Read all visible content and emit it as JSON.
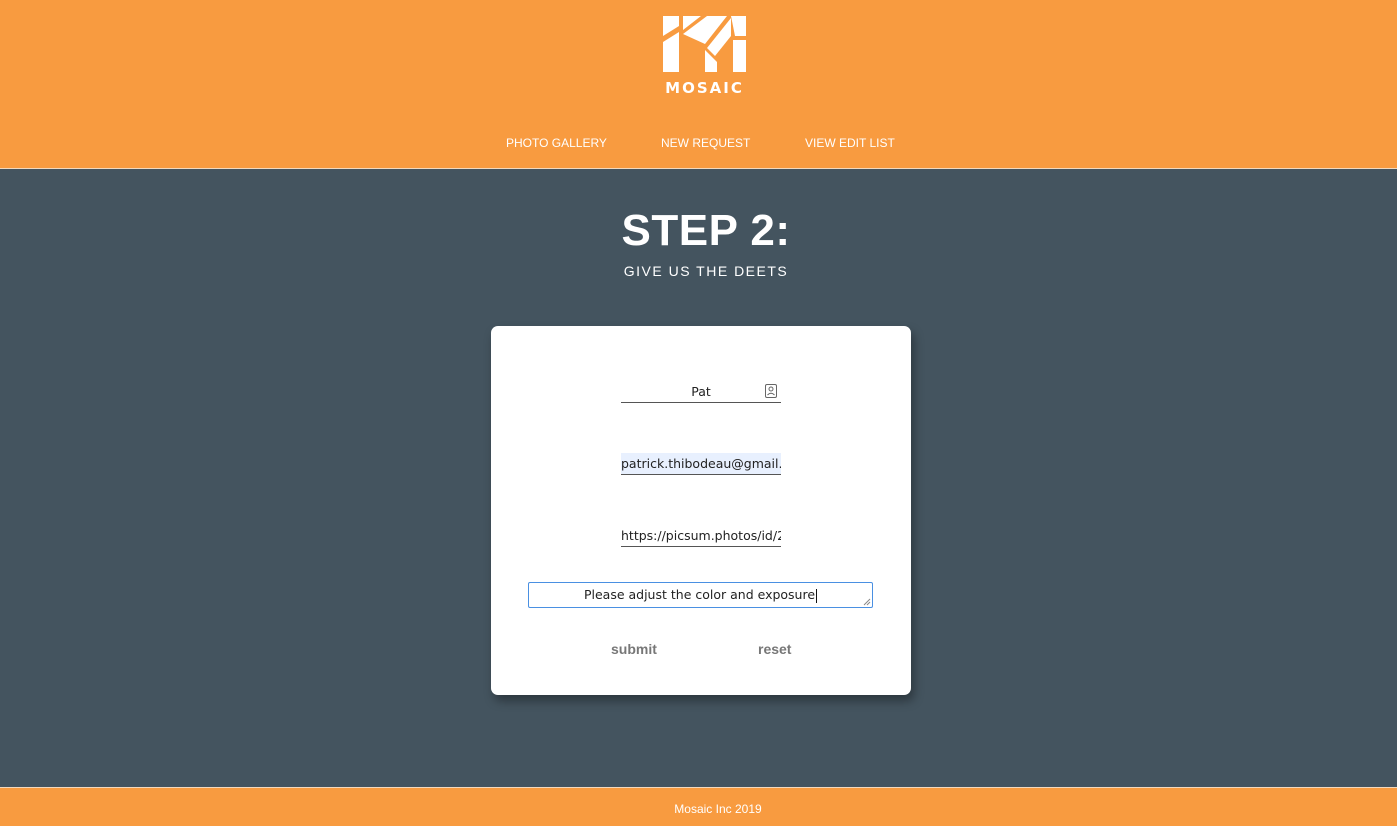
{
  "header": {
    "logo_text": "MOSAIC",
    "nav": [
      {
        "label": "PHOTO GALLERY"
      },
      {
        "label": "NEW REQUEST"
      },
      {
        "label": "VIEW EDIT LIST"
      }
    ]
  },
  "main": {
    "title": "STEP 2:",
    "subtitle": "GIVE US THE DEETS"
  },
  "form": {
    "name_value": "Pat",
    "email_value": "patrick.thibodeau@gmail.c",
    "url_value": "https://picsum.photos/id/2",
    "description_value": "Please adjust the color and exposure",
    "submit_label": "submit",
    "reset_label": "reset"
  },
  "footer": {
    "text": "Mosaic Inc 2019"
  },
  "colors": {
    "brand_orange": "#f89b40",
    "background_slate": "#44545f",
    "focus_blue": "#4a90e2",
    "autofill_blue": "#e8f0fe"
  },
  "icons": {
    "logo": "mosaic-m-logo",
    "field_icon": "contact-card-icon"
  }
}
